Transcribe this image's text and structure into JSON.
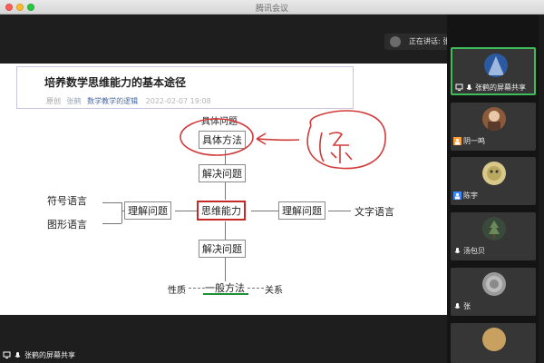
{
  "window": {
    "title": "腾讯会议"
  },
  "article": {
    "title": "培养数学思维能力的基本途径",
    "tag": "原创",
    "author": "张鹤",
    "account": "数学教学的逻辑",
    "date": "2022-02-07 19:08"
  },
  "mindmap": {
    "top_label": "具体问题",
    "top_method": "具体方法",
    "solve_top": "解决问题",
    "center": "思维能力",
    "left_box": "理解问题",
    "right_box": "理解问题",
    "symbol_lang": "符号语言",
    "graph_lang": "图形语言",
    "text_lang": "文字语言",
    "solve_bottom": "解决问题",
    "nature": "性质",
    "general_method": "一般方法",
    "relation": "关系",
    "annotation": "(东)"
  },
  "speaker": {
    "text": "正在讲话: 张鹤;"
  },
  "participants": [
    {
      "name": "张鹤的屏幕共享",
      "icon": "screen-share-icon"
    },
    {
      "name": "阴一鸣",
      "icon": "user-icon"
    },
    {
      "name": "陈宇",
      "icon": "user-icon"
    },
    {
      "name": "汤包贝",
      "icon": "mic-icon"
    },
    {
      "name": "张",
      "icon": "mic-icon"
    }
  ],
  "bottom": {
    "label": "张鹤的屏幕共享"
  },
  "colors": {
    "accent_green": "#3fbd5a",
    "highlight_red": "#c42a2a",
    "link_blue": "#4868a6"
  }
}
